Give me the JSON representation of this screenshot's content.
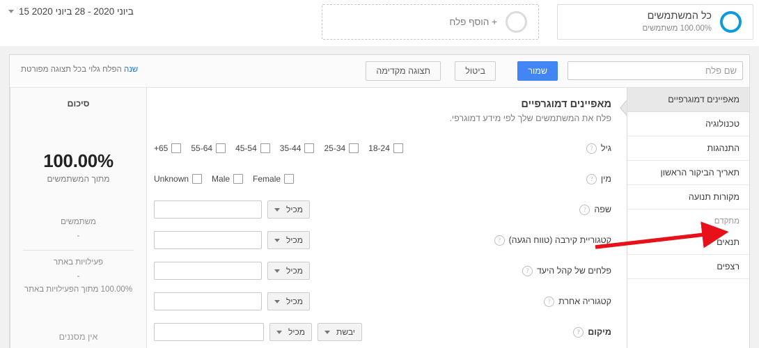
{
  "topbar": {
    "date_range": "15 ביוני 2020 - 28 ביוני 2020",
    "date_caret_icon": "chevron-down-icon",
    "all_users_card": {
      "title": "כל המשתמשים",
      "subtitle": "100.00% משתמשים",
      "ring_icon": "segment-ring-icon",
      "ring_color": "#0f9bd7"
    },
    "add_segment_card": {
      "label": "+ הוסף פלח",
      "ring_icon": "segment-ring-empty-icon",
      "ring_color": "#dcdcdc"
    }
  },
  "toolbar": {
    "name_placeholder": "שם פלח",
    "name_value": "",
    "save_label": "שמור",
    "cancel_label": "ביטול",
    "preview_label": "תצוגה מקדימה",
    "visibility_note": "הפלח גלוי בכל תצוגה מפורטת",
    "change_link": "שנה",
    "save_color": "#4285f4"
  },
  "nav": {
    "items": [
      {
        "label": "מאפיינים דמוגרפיים",
        "active": true
      },
      {
        "label": "טכנולוגיה",
        "active": false
      },
      {
        "label": "התנהגות",
        "active": false
      },
      {
        "label": "תאריך הביקור הראשון",
        "active": false
      },
      {
        "label": "מקורות תנועה",
        "active": false
      }
    ],
    "section_label": "מתקדם",
    "advanced_items": [
      {
        "label": "תנאים",
        "active": false
      },
      {
        "label": "רצפים",
        "active": false
      }
    ]
  },
  "panel": {
    "title": "מאפיינים דמוגרפיים",
    "subtitle": "פלח את המשתמשים שלך לפי מידע דמוגרפי.",
    "help_icon": "question-mark-icon",
    "age": {
      "label": "גיל",
      "options": [
        "18-24",
        "25-34",
        "35-44",
        "45-54",
        "55-64",
        "+65"
      ],
      "checked": []
    },
    "gender": {
      "label": "מין",
      "options": [
        "Female",
        "Male",
        "Unknown"
      ],
      "checked": []
    },
    "rows": [
      {
        "label": "שפה",
        "operator": "מכיל",
        "value": ""
      },
      {
        "label": "קטגוריית קירבה (טווח הגעה)",
        "operator": "מכיל",
        "value": ""
      },
      {
        "label": "פלחים של קהל היעד",
        "operator": "מכיל",
        "value": ""
      },
      {
        "label": "קטגוריה אחרת",
        "operator": "מכיל",
        "value": ""
      }
    ],
    "location": {
      "label": "מיקום",
      "scope": "יבשת",
      "operator": "מכיל",
      "value": ""
    }
  },
  "summary": {
    "title": "סיכום",
    "percent": "100.00%",
    "percent_sub": "מתוך המשתמשים",
    "users_label": "משתמשים",
    "users_value": "-",
    "sessions_label": "פעילויות באתר",
    "sessions_value": "-",
    "sessions_pct": "100.00% מתוך הפעילויות באתר",
    "no_filters": "אין מסננים"
  },
  "annotation": {
    "arrow_color": "#e8111a",
    "arrow_target": "תנאים"
  }
}
